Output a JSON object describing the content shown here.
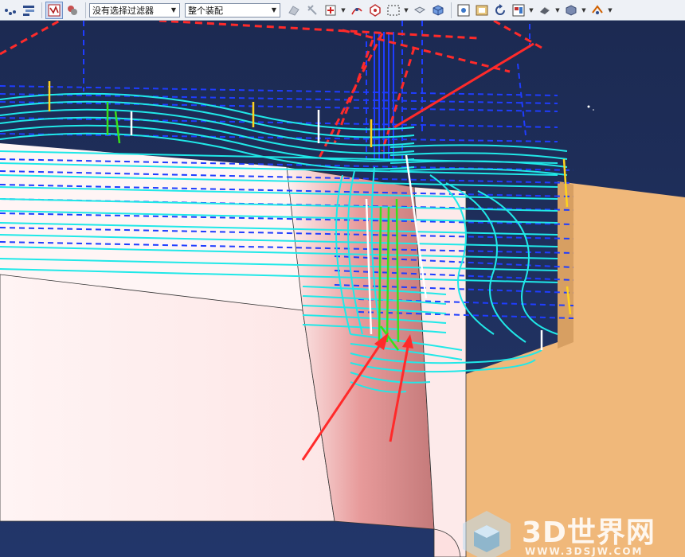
{
  "toolbar": {
    "filter_combo": {
      "value": "没有选择过滤器"
    },
    "scope_combo": {
      "value": "整个装配"
    },
    "icons": [
      "snap-point-icon",
      "snap-grid-icon",
      "selection-filter-icon",
      "feature-filter-icon",
      "select-body-icon",
      "select-face-icon",
      "point-constructor-icon",
      "point-on-curve-icon",
      "polygon-select-icon",
      "rectangle-select-icon",
      "wireframe-view-icon",
      "shaded-view-icon",
      "fit-view-icon",
      "background-icon",
      "refresh-icon",
      "layout-icon",
      "display-mode-icon",
      "render-style-icon",
      "orient-view-icon"
    ]
  },
  "viewport": {
    "background_top": "#1c2a52",
    "background_bottom": "#22366a",
    "toolpath_colors": {
      "cut": "#20e8e8",
      "rapid": "#1f3dff",
      "engage": "#ffd21e",
      "plunge": "#38e01a",
      "retract": "#ff2a2a"
    },
    "part_color": "#fff1f1",
    "wall_color": "#c47a7a",
    "stock_color": "#f0b87a"
  },
  "watermark": {
    "text": "3D世界网",
    "url": "WWW.3DSJW.COM"
  }
}
